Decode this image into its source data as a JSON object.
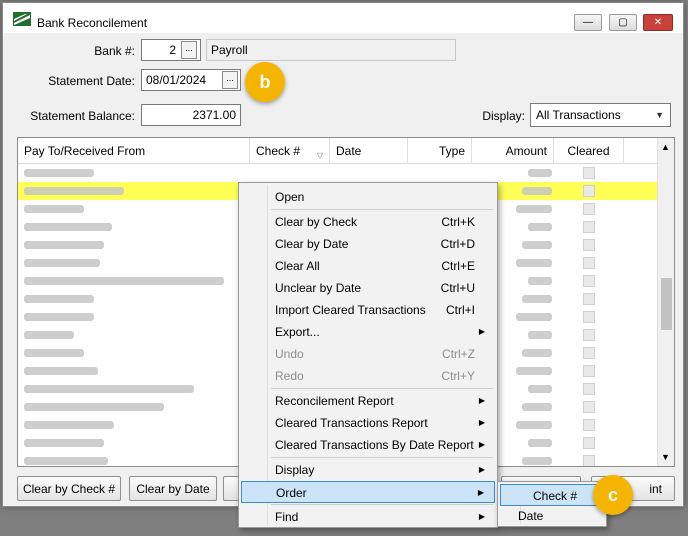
{
  "window": {
    "title": "Bank Reconcilement",
    "icon": "app-logo-icon"
  },
  "form": {
    "bank_label": "Bank #:",
    "bank_value": "2",
    "bank_name": "Payroll",
    "statement_date_label": "Statement Date:",
    "statement_date_value": "08/01/2024",
    "statement_balance_label": "Statement Balance:",
    "statement_balance_value": "2371.00",
    "display_label": "Display:",
    "display_value": "All Transactions"
  },
  "grid": {
    "columns": [
      "Pay To/Received From",
      "Check #",
      "Date",
      "Type",
      "Amount",
      "Cleared"
    ]
  },
  "buttons": {
    "clear_by_check": "Clear by Check #",
    "clear_by_date": "Clear by Date",
    "print_partial": "int"
  },
  "context_menu": {
    "items": [
      {
        "label": "Open",
        "shortcut": ""
      },
      {
        "label": "Clear by Check",
        "shortcut": "Ctrl+K"
      },
      {
        "label": "Clear by Date",
        "shortcut": "Ctrl+D"
      },
      {
        "label": "Clear All",
        "shortcut": "Ctrl+E"
      },
      {
        "label": "Unclear by Date",
        "shortcut": "Ctrl+U"
      },
      {
        "label": "Import Cleared Transactions",
        "shortcut": "Ctrl+I"
      },
      {
        "label": "Export...",
        "shortcut": ""
      },
      {
        "label": "Undo",
        "shortcut": "Ctrl+Z"
      },
      {
        "label": "Redo",
        "shortcut": "Ctrl+Y"
      },
      {
        "label": "Reconcilement Report",
        "shortcut": ""
      },
      {
        "label": "Cleared Transactions Report",
        "shortcut": ""
      },
      {
        "label": "Cleared Transactions By Date Report",
        "shortcut": ""
      },
      {
        "label": "Display",
        "shortcut": ""
      },
      {
        "label": "Order",
        "shortcut": ""
      },
      {
        "label": "Find",
        "shortcut": ""
      }
    ],
    "submenu": [
      "Check #",
      "Date"
    ]
  },
  "callouts": {
    "b": "b",
    "c": "c"
  },
  "colors": {
    "highlight_row": "#ffff55",
    "menu_highlight": "#cce4f7",
    "callout": "#f4b400"
  }
}
